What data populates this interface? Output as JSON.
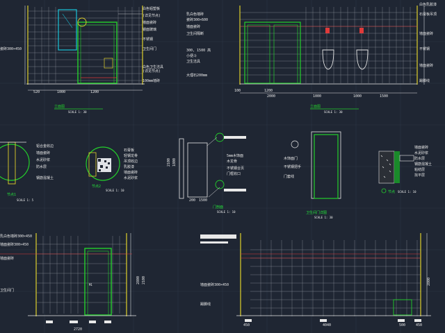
{
  "colors": {
    "background": "#1f2633",
    "wall_line": "#e0d12a",
    "fixture": "#23d12b",
    "glass": "#19c4d8",
    "tile_line": "#e03a3a",
    "text": "#e8e8e8"
  },
  "elev_a": {
    "title": "立面图",
    "scale": "SCALE 1: 30",
    "notes": [
      "白色铝塑板",
      "(详见节点)",
      "墙面瓷砖",
      "镜面玻璃",
      "不锈钢",
      "卫生间门",
      "白色卫生洁具",
      "(详见节点)",
      "100mm墙砖"
    ],
    "left_note": "瓷砖300×450",
    "dims": [
      "520",
      "1000",
      "1200"
    ]
  },
  "elev_b": {
    "title": "立面图",
    "scale": "SCALE 1: 30",
    "notes_left": [
      "乳白色墙砖",
      "瓷砖300×600",
      "墙面瓷砖",
      "卫生间隔断",
      "300, 1500 高",
      "小便斗",
      "卫生洁具",
      "大理石200mm"
    ],
    "notes_right": [
      "白色乳胶漆",
      "石膏板吊顶",
      "墙面瓷砖",
      "不锈钢",
      "墙面瓷砖",
      "踢脚线"
    ],
    "dims": [
      "100",
      "1200",
      "2000",
      "1000",
      "1000",
      "1500"
    ]
  },
  "detail1": {
    "title": "节点1",
    "scale": "SCALE 1: 5",
    "notes": [
      "铝合金收边",
      "墙面瓷砖",
      "水泥砂浆",
      "防水层",
      "钢筋混凝土"
    ]
  },
  "detail2": {
    "title": "节点2",
    "scale": "SCALE 1: 10",
    "notes": [
      "石膏板",
      "轻钢龙骨",
      "吊顶收边",
      "乳胶漆",
      "墙面瓷砖",
      "水泥砂浆"
    ]
  },
  "detail3": {
    "title": "门剖面",
    "scale": "SCALE 1: 10",
    "dims": [
      "2100",
      "1800",
      "200",
      "1500"
    ],
    "notes": [
      "5mm木饰面",
      "木龙骨",
      "不锈钢合页",
      "门框收口"
    ]
  },
  "detail4": {
    "title": "卫生间门详图",
    "scale": "SCALE 1: 30",
    "notes": [
      "木饰面门",
      "不锈钢把手",
      "门套线"
    ]
  },
  "detail5": {
    "title": "节点",
    "scale": "SCALE 1: 10",
    "notes": [
      "墙面瓷砖",
      "水泥砂浆",
      "防水层",
      "钢筋混凝土",
      "粘结层",
      "找平层"
    ]
  },
  "elev_c": {
    "door_label": "M1",
    "notes": [
      "乳白色墙砖300×450",
      "墙面瓷砖300×450",
      "墙面瓷砖",
      "卫生间门"
    ],
    "dims": [
      "2800",
      "2100",
      "2720"
    ]
  },
  "elev_d": {
    "notes": [
      "墙面瓷砖300×450",
      "踢脚线"
    ],
    "dims": [
      "2800",
      "450",
      "4040",
      "500",
      "450"
    ]
  }
}
